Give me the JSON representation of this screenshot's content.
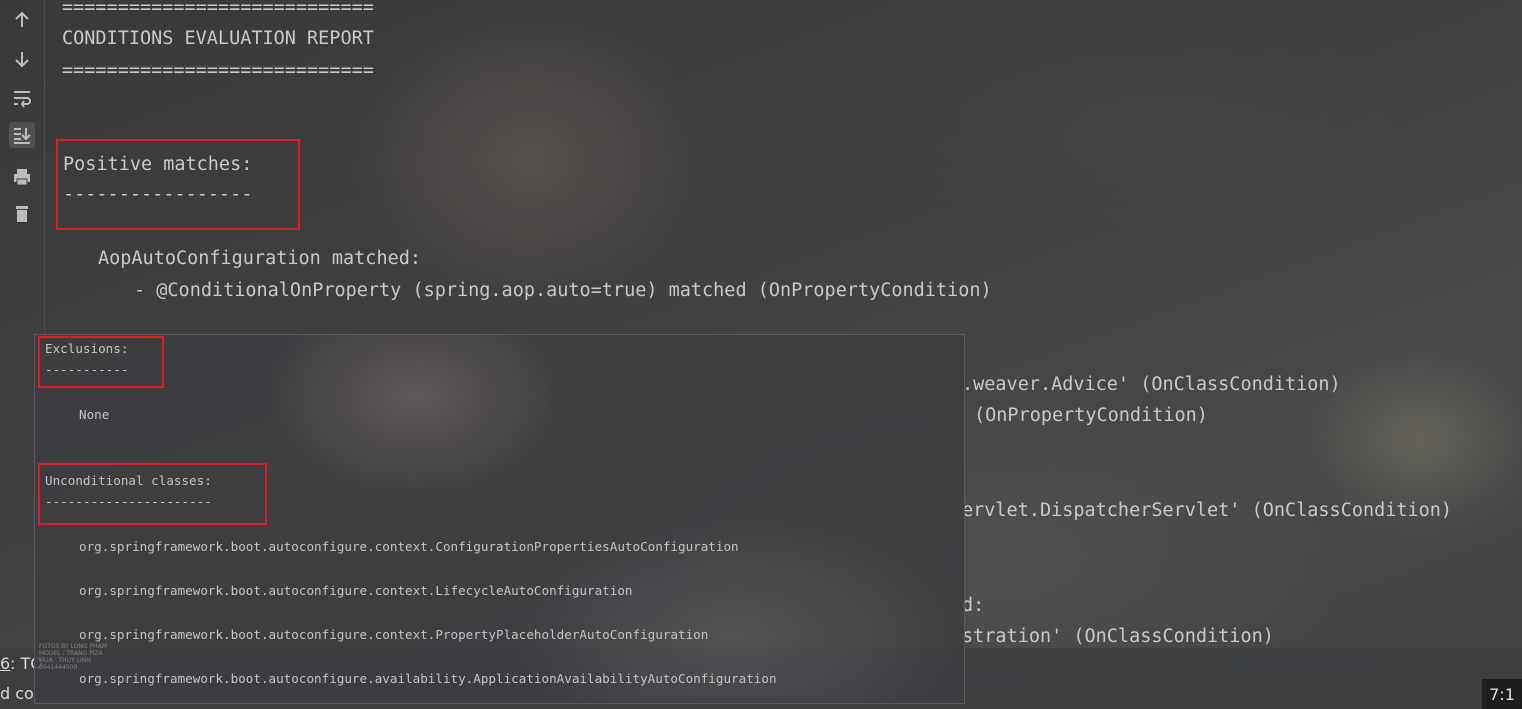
{
  "toolbar": {
    "icons": [
      "arrow-up-icon",
      "arrow-down-icon",
      "soft-wrap-icon",
      "scroll-to-end-icon",
      "print-icon",
      "trash-icon"
    ]
  },
  "console": {
    "separator_top": "============================",
    "report_title": "CONDITIONS EVALUATION REPORT",
    "separator_bottom": "============================",
    "positive_matches": "Positive matches:",
    "positive_underline": "-----------------",
    "aop_matched": "AopAutoConfiguration matched:",
    "aop_condition": "- @ConditionalOnProperty (spring.aop.auto=true) matched (OnPropertyCondition)",
    "partial_1": ".weaver.Advice' (OnClassCondition)",
    "partial_2": "(OnPropertyCondition)",
    "partial_3": "ervlet.DispatcherServlet' (OnClassCondition)",
    "partial_4": "d:",
    "partial_5": "stration' (OnClassCondition)"
  },
  "popup": {
    "exclusions_label": "Exclusions:",
    "exclusions_underline": "-----------",
    "exclusions_value": "None",
    "unconditional_label": "Unconditional classes:",
    "unconditional_underline": "----------------------",
    "classes": [
      "org.springframework.boot.autoconfigure.context.ConfigurationPropertiesAutoConfiguration",
      "org.springframework.boot.autoconfigure.context.LifecycleAutoConfiguration",
      "org.springframework.boot.autoconfigure.context.PropertyPlaceholderAutoConfiguration",
      "org.springframework.boot.autoconfigure.availability.ApplicationAvailabilityAutoConfiguration"
    ],
    "watermark": "FOTOS BY LONG PHAM\nMODEL : TRANG PIZA\nMUA : THUY LINH\n0941444500"
  },
  "statusbar": {
    "tab_number": "6",
    "tab_label": ": TO",
    "bottom_text": "d co",
    "position": "7:1"
  },
  "colors": {
    "highlight_box": "#e21b23",
    "console_text": "#c9c9c9"
  }
}
